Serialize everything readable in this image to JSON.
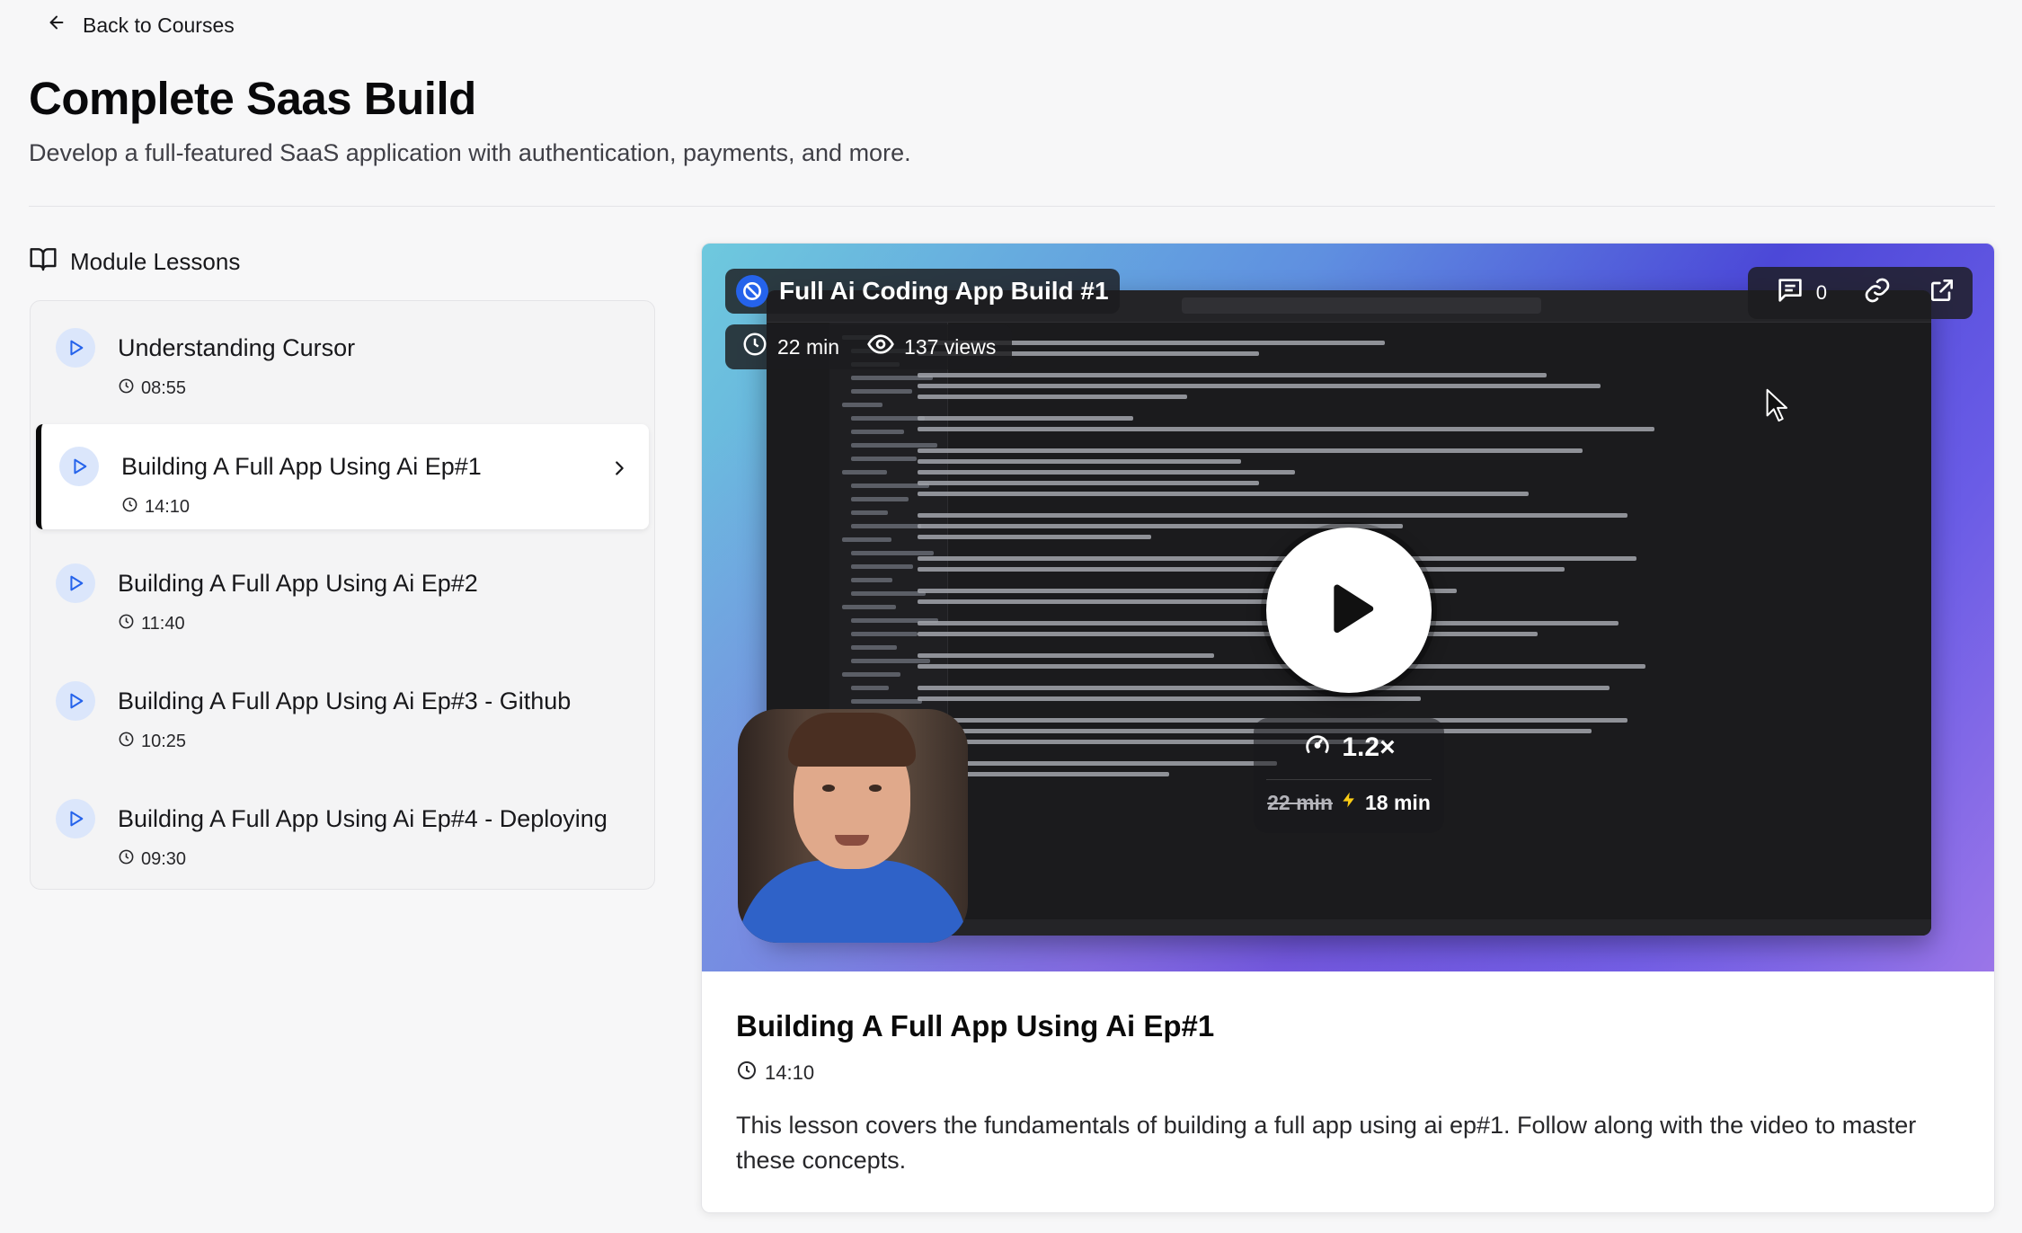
{
  "nav": {
    "back_label": "Back to Courses"
  },
  "course": {
    "title": "Complete Saas Build",
    "subtitle": "Develop a full-featured SaaS application with authentication, payments, and more."
  },
  "module": {
    "heading": "Module Lessons",
    "lessons": [
      {
        "title": "Understanding Cursor",
        "duration": "08:55",
        "active": false
      },
      {
        "title": "Building A Full App Using Ai Ep#1",
        "duration": "14:10",
        "active": true
      },
      {
        "title": "Building A Full App Using Ai Ep#2",
        "duration": "11:40",
        "active": false
      },
      {
        "title": "Building A Full App Using Ai Ep#3 - Github",
        "duration": "10:25",
        "active": false
      },
      {
        "title": "Building A Full App Using Ai Ep#4 - Deploying",
        "duration": "09:30",
        "active": false
      }
    ]
  },
  "video": {
    "title": "Full Ai Coding App Build #1",
    "length": "22 min",
    "views": "137 views",
    "comments": "0",
    "speed": "1.2×",
    "original_time": "22 min",
    "fast_time": "18 min",
    "accent": "#2563eb"
  },
  "lesson_detail": {
    "title": "Building A Full App Using Ai Ep#1",
    "duration": "14:10",
    "description": "This lesson covers the fundamentals of building a full app using ai ep#1. Follow along with the video to master these concepts."
  }
}
